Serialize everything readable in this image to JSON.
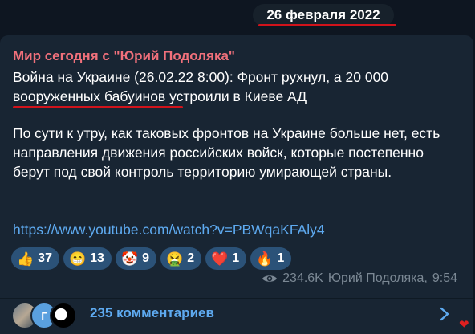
{
  "date_label": "26 февраля 2022",
  "post": {
    "channel_name": "Мир сегодня с \"Юрий Подоляка\"",
    "headline": "Война на Украине (26.02.22 8:00): Фронт рухнул, а 20 000 вооруженных бабуинов устроили в Киеве АД",
    "body": "По сути к утру, как таковых фронтов на Украине больше нет, есть направления движения российских войск, которые постепенно берут под свой контроль территорию умирающей страны.",
    "link": "https://www.youtube.com/watch?v=PBWqaKFAly4"
  },
  "reactions": [
    {
      "emoji": "👍",
      "count": "37",
      "icon": "thumbs-up"
    },
    {
      "emoji": "😁",
      "count": "13",
      "icon": "grinning-face"
    },
    {
      "emoji": "🤡",
      "count": "9",
      "icon": "clown-face"
    },
    {
      "emoji": "🤮",
      "count": "2",
      "icon": "vomiting-face"
    },
    {
      "emoji": "❤️",
      "count": "1",
      "icon": "heart"
    },
    {
      "emoji": "🔥",
      "count": "1",
      "icon": "fire"
    }
  ],
  "meta": {
    "views": "234.6K",
    "author": "Юрий Подоляка",
    "time": "9:54"
  },
  "comments": {
    "avatar_letter": "Г",
    "label": "235 комментариев"
  },
  "colors": {
    "background": "#0e1621",
    "bubble": "#182533",
    "channel_name": "#f0707b",
    "link": "#5eaaf0",
    "reaction_bg": "#2b5278",
    "annotation_red": "#d1131b"
  }
}
